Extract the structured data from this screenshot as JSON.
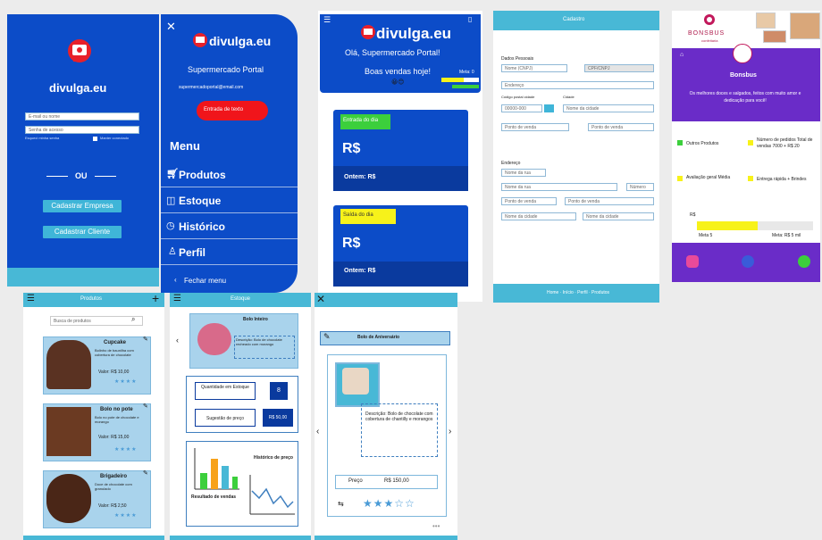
{
  "colors": {
    "primary_blue": "#0c4cc8",
    "dark_blue": "#0a3a9e",
    "teal": "#48b8d6",
    "red": "#e8202a",
    "green": "#3ccf3c",
    "yellow": "#f7f21a",
    "purple": "#6a2cc8"
  },
  "login": {
    "brand": "divulga.eu",
    "email_placeholder": "E-mail ou nome",
    "password_placeholder": "Senha de acesso",
    "forgot": "Esqueci minha senha",
    "remember": "Manter conectado",
    "divider": "OU",
    "btn_company": "Cadastrar Empresa",
    "btn_client": "Cadastrar Cliente"
  },
  "menu": {
    "brand": "divulga.eu",
    "store": "Supermercado Portal",
    "email": "supermercadoportal@email.com",
    "cta": "Entrada de texto",
    "title": "Menu",
    "items": [
      "Produtos",
      "Estoque",
      "Histórico",
      "Perfil"
    ],
    "close": "Fechar menu"
  },
  "dashboard": {
    "brand": "divulga.eu",
    "greeting": "Olá, Supermercado Portal!",
    "wish": "Boas vendas hoje!",
    "meta_label": "Meta: 0",
    "card1_tag": "Entrada do dia",
    "card1_value": "R$",
    "card1_foot": "Ontem: R$",
    "card2_tag": "Saída do dia",
    "card2_value": "R$",
    "card2_foot": "Ontem: R$"
  },
  "cadastro": {
    "title": "Cadastro",
    "section1": "Dados Pessoais",
    "nome": "Nome (CNPJ)",
    "sobrenome": "CPF/CNPJ",
    "endereco": "Endereço",
    "cep_label": "Código postal cidade",
    "cidade_label": "Cidade",
    "cep": "00000-000",
    "cidade": "Nome da cidade",
    "f1": "Ponto de venda",
    "f2": "Ponto de venda",
    "section2": "Endereço",
    "rua": "Nome da rua",
    "f3": "Nome da rua",
    "numero": "Número",
    "f4": "Ponto de venda",
    "f5": "Ponto de venda",
    "f6": "Nome da cidade",
    "f7": "Nome da cidade",
    "footer": "Home · Início · Perfil · Produtos"
  },
  "bonsbus": {
    "logo": "BONSBUS",
    "logo_sub": "confeitaria",
    "name": "Bonsbus",
    "tagline": "Os melhores doces e salgados, feitos com muito amor e dedicação para você!",
    "stat1": "Outros Produtos",
    "stat2": "Número de pedidos Total de vendas 7000 + R$ 20",
    "stat3": "Avaliação geral Média",
    "stat4": "Entrega rápida + Brindes",
    "progress_label": "R$",
    "progress_left": "Meta 5",
    "progress_right": "Meta: R$ 5 mil"
  },
  "produtos": {
    "title": "Produtos",
    "search_placeholder": "Busca de produtos",
    "items": [
      {
        "name": "Cupcake",
        "desc": "Bolinho de baunilha com cobertura de chocolate",
        "price": "Valor: R$ 10,00"
      },
      {
        "name": "Bolo no pote",
        "desc": "Bolo no pote de chocolate e morango",
        "price": "Valor: R$ 15,00"
      },
      {
        "name": "Brigadeiro",
        "desc": "Doce de chocolate com granulado",
        "price": "Valor: R$ 2,50"
      }
    ]
  },
  "estoque": {
    "title": "Estoque",
    "featured_title": "Bolo Inteiro",
    "featured_desc": "Descrição: Bolo de chocolate recheado com morango",
    "qty_label": "Quantidade em Estoque",
    "qty_value": "8",
    "price_label": "Sugestão de preço",
    "price_value": "R$ 50,00",
    "chart_label1": "Resultado de vendas",
    "chart_label2": "Histórico de preço"
  },
  "detalhe": {
    "title": "Bolo de Aniversário",
    "desc": "Descrição: Bolo de chocolate com cobertura de chantilly e morangos",
    "price_label": "Preço",
    "price_value": "R$ 150,00",
    "rating": 3
  }
}
